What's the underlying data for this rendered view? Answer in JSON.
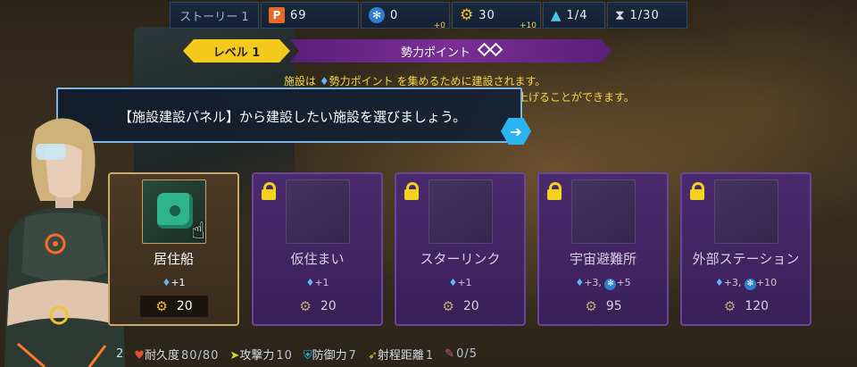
{
  "topbar": {
    "story": "ストーリー 1",
    "points_value": "69",
    "blue_value": "0",
    "blue_sub": "+0",
    "gear_value": "30",
    "gear_sub": "+10",
    "ships_value": "1/4",
    "turn_value": "1/30"
  },
  "level": {
    "label": "レベル 1",
    "power_label": "勢力ポイント"
  },
  "info": {
    "line1_pre": "施設は",
    "line1_mid": "勢力ポイント",
    "line1_post": "を集めるために建設されます。",
    "line2": "上げることができます。"
  },
  "dialog": {
    "text": "【施設建設パネル】から建設したい施設を選びましょう。"
  },
  "cards": [
    {
      "name": "居住船",
      "reward": "+1",
      "cost": "20",
      "state": "active"
    },
    {
      "name": "仮住まい",
      "reward": "+1",
      "cost": "20",
      "state": "locked"
    },
    {
      "name": "スターリンク",
      "reward": "+1",
      "cost": "20",
      "state": "locked"
    },
    {
      "name": "宇宙避難所",
      "reward": "+3,",
      "reward2": "+5",
      "cost": "95",
      "state": "locked"
    },
    {
      "name": "外部ステーション",
      "reward": "+3,",
      "reward2": "+10",
      "cost": "120",
      "state": "locked"
    }
  ],
  "stats": {
    "level_num": "2",
    "durability_label": "耐久度",
    "durability_value": "80/80",
    "attack_label": "攻撃力",
    "attack_value": "10",
    "defense_label": "防御力",
    "defense_value": "7",
    "range_label": "射程距離",
    "range_value": "1",
    "slots_value": "0/5"
  },
  "colors": {
    "accent_yellow": "#f3c91c",
    "accent_purple": "#7a2f95",
    "accent_cyan": "#2ab5f0"
  }
}
